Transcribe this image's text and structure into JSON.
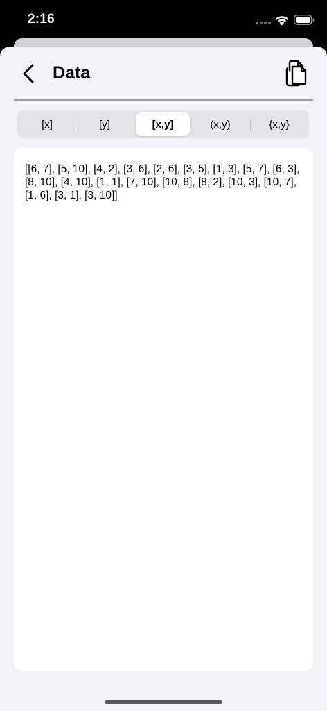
{
  "status_bar": {
    "time": "2:16"
  },
  "nav": {
    "title": "Data",
    "back_icon": "chevron-left-icon",
    "copy_icon": "copy-documents-icon"
  },
  "segments": [
    {
      "label": "[x]",
      "selected": false
    },
    {
      "label": "[y]",
      "selected": false
    },
    {
      "label": "[x,y]",
      "selected": true
    },
    {
      "label": "(x,y)",
      "selected": false
    },
    {
      "label": "{x,y}",
      "selected": false
    }
  ],
  "content": {
    "text": "[[6, 7], [5, 10], [4, 2], [3, 6], [2, 6], [3, 5], [1, 3], [5, 7], [6, 3], [8, 10], [4, 10], [1, 1], [7, 10], [10, 8], [8, 2], [10, 3], [10, 7], [1, 6], [3, 1], [3, 10]]"
  },
  "colors": {
    "background": "#f2f2f7",
    "card": "#ffffff",
    "segment_track": "#e3e3e8",
    "status_bar": "#000000"
  }
}
